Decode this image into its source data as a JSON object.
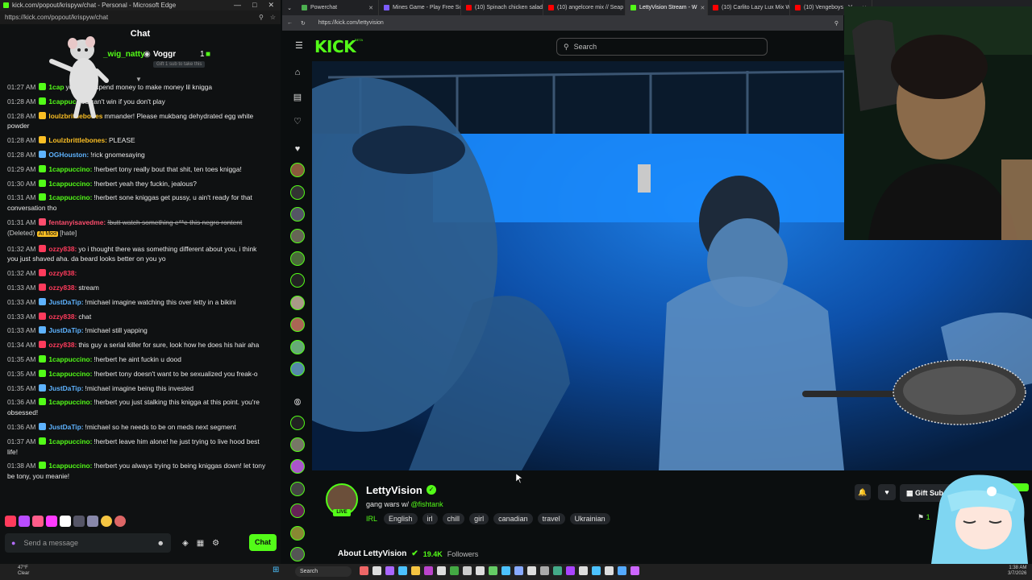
{
  "popout": {
    "window_title": "kick.com/popout/krispyw/chat - Personal - Microsoft Edge",
    "url": "https://kick.com/popout/krispyw/chat",
    "chat_header": "Chat",
    "pinned": {
      "user": "_wig_natty",
      "gifter": "Voggr",
      "gift_count": "1",
      "gift_note": "Gift 1 sub to take this"
    },
    "messages": [
      {
        "time": "01:27 AM",
        "user": "1cap",
        "text": "you gotta spend money to make money lil knigga",
        "color": "#53fc18"
      },
      {
        "time": "01:28 AM",
        "user": "1cappuc",
        "text": "you can't win if you don't play",
        "color": "#53fc18"
      },
      {
        "time": "01:28 AM",
        "user": "loulzbrittlebones",
        "text": "mmander! Please mukbang dehydrated egg white powder",
        "color": "#fbbf24"
      },
      {
        "time": "01:28 AM",
        "user": "Loulzbrittlebones:",
        "text": "PLEASE",
        "color": "#fbbf24"
      },
      {
        "time": "01:28 AM",
        "user": "OGHouston:",
        "text": "!rick gnomesaying",
        "color": "#5eb3ff"
      },
      {
        "time": "01:29 AM",
        "user": "1cappuccino:",
        "text": "!herbert tony really bout that shit, ten toes knigga!",
        "color": "#53fc18"
      },
      {
        "time": "01:30 AM",
        "user": "1cappuccino:",
        "text": "!herbert yeah they fuckin, jealous?",
        "color": "#53fc18"
      },
      {
        "time": "01:31 AM",
        "user": "1cappuccino:",
        "text": "!herbert sone kniggas get pussy, u ain't ready for that conversation tho",
        "color": "#53fc18"
      },
      {
        "time": "01:31 AM",
        "user": "fentanyisavedme:",
        "text": "!butt watch something e**e this negro rontent",
        "deleted": "(Deleted)",
        "mod_tag": "AI Mod",
        "tag2": "[hate]",
        "color": "#ff4d6d",
        "strike": true
      },
      {
        "time": "01:32 AM",
        "user": "ozzy838:",
        "text": "yo i thought there was something different about you, i think you just shaved aha. da beard looks better on you yo",
        "color": "#ff3b5c"
      },
      {
        "time": "01:32 AM",
        "user": "ozzy838:",
        "text": "",
        "color": "#ff3b5c"
      },
      {
        "time": "01:33 AM",
        "user": "ozzy838:",
        "text": "stream",
        "color": "#ff3b5c"
      },
      {
        "time": "01:33 AM",
        "user": "JustDaTip:",
        "text": "!michael imagine watching this over letty in a bikini",
        "color": "#5eb3ff"
      },
      {
        "time": "01:33 AM",
        "user": "ozzy838:",
        "text": "chat",
        "color": "#ff3b5c"
      },
      {
        "time": "01:33 AM",
        "user": "JustDaTip:",
        "text": "!michael still yapping",
        "color": "#5eb3ff"
      },
      {
        "time": "01:34 AM",
        "user": "ozzy838:",
        "text": "this guy a serial killer for sure, look how he does his hair aha",
        "color": "#ff3b5c"
      },
      {
        "time": "01:35 AM",
        "user": "1cappuccino:",
        "text": "!herbert he aint fuckin u dood",
        "color": "#53fc18"
      },
      {
        "time": "01:35 AM",
        "user": "1cappuccino:",
        "text": "!herbert tony doesn't want to be sexualized you freak-o",
        "color": "#53fc18"
      },
      {
        "time": "01:35 AM",
        "user": "JustDaTip:",
        "text": "!michael imagine being this invested",
        "color": "#5eb3ff"
      },
      {
        "time": "01:36 AM",
        "user": "1cappuccino:",
        "text": "!herbert you just stalking this knigga at this point. you're obsessed!",
        "color": "#53fc18"
      },
      {
        "time": "01:36 AM",
        "user": "JustDaTip:",
        "text": "!michael so he needs to be on meds next segment",
        "color": "#5eb3ff"
      },
      {
        "time": "01:37 AM",
        "user": "1cappuccino:",
        "text": "!herbert leave him alone! he just trying to live hood best life!",
        "color": "#53fc18"
      },
      {
        "time": "01:38 AM",
        "user": "1cappuccino:",
        "text": "!herbert you always trying to being kniggas down! let tony be tony, you meanie!",
        "color": "#53fc18"
      }
    ],
    "send_placeholder": "Send a message",
    "chat_button": "Chat"
  },
  "browser": {
    "tabs": [
      {
        "label": "Powerchat",
        "color": "#4caf50"
      },
      {
        "label": "Mines Game - Play Free Sc",
        "color": "#7c5cff"
      },
      {
        "label": "(10) Spinach chicken salad",
        "color": "#ff0000"
      },
      {
        "label": "(10) angelcore mix // Seap",
        "color": "#ff0000"
      },
      {
        "label": "LettyVision Stream - W",
        "color": "#53fc18",
        "active": true
      },
      {
        "label": "(10) Carlito Lazy Lux Mix W",
        "color": "#ff0000"
      },
      {
        "label": "(10) Vengeboys - V",
        "color": "#ff0000"
      }
    ],
    "url": "https://kick.com/lettyvision"
  },
  "kick": {
    "logo": "KICK",
    "logo_beta": "BETA",
    "search_placeholder": "Search",
    "channel_name": "LettyVision",
    "live": "LIVE",
    "stream_title": "gang wars w/ ",
    "stream_mention": "@fishtank",
    "category": "IRL",
    "tags": [
      "English",
      "irl",
      "chill",
      "girl",
      "canadian",
      "travel",
      "Ukrainian"
    ],
    "gift_subs": "Gift Sub",
    "viewers": "1",
    "about_label": "About LettyVision",
    "followers": "19.4K",
    "followers_label": "Followers"
  },
  "taskbar": {
    "weather_temp": "47°F",
    "weather_desc": "Clear",
    "search": "Search",
    "time": "1:38 AM",
    "date": "3/7/2026"
  },
  "colors": {
    "kick_green": "#53fc18",
    "bg": "#0b0e0f"
  }
}
